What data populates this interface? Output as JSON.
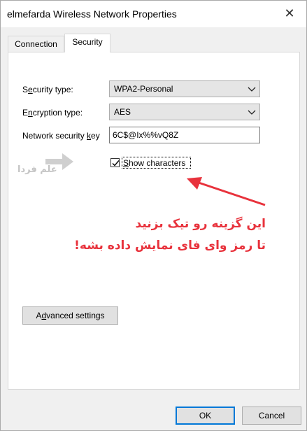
{
  "window": {
    "title": "elmefarda Wireless Network Properties"
  },
  "tabs": [
    {
      "label": "Connection",
      "active": false
    },
    {
      "label": "Security",
      "active": true
    }
  ],
  "security": {
    "type_label_pre": "S",
    "type_label_key": "e",
    "type_label_post": "curity type:",
    "type_value": "WPA2-Personal",
    "enc_label_pre": "E",
    "enc_label_key": "n",
    "enc_label_post": "cryption type:",
    "enc_value": "AES",
    "key_label_pre": "Network security ",
    "key_label_key": "k",
    "key_label_post": "ey",
    "key_value": "6C$@Ix%%vQ8Z",
    "show_chars_pre": "",
    "show_chars_key": "S",
    "show_chars_post": "how characters",
    "show_chars_checked": true
  },
  "annotation": {
    "line1": "این گزینه رو تیک بزنید",
    "line2": "تا رمز وای فای نمایش داده بشه!",
    "color": "#e8323c"
  },
  "watermark": {
    "text": "علم فردا"
  },
  "advanced_button": {
    "pre": "A",
    "key": "d",
    "post": "vanced settings"
  },
  "footer": {
    "ok_label": "OK",
    "cancel_label": "Cancel"
  },
  "icons": {
    "close": "close-icon",
    "dropdown": "chevron-down-icon",
    "check": "checkmark-icon",
    "arrow": "arrow-icon"
  }
}
